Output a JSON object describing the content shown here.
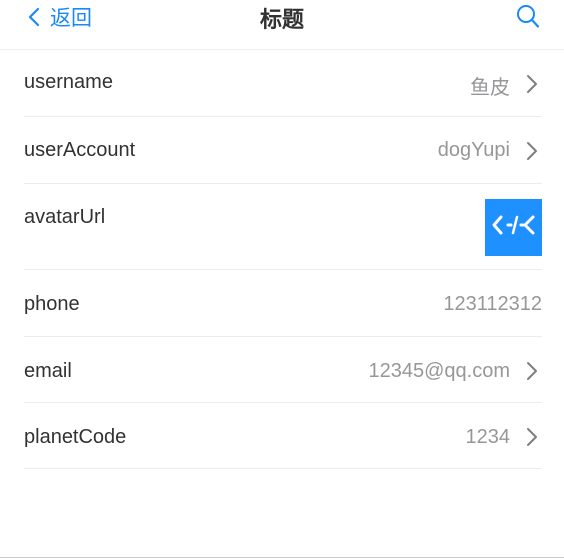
{
  "navbar": {
    "back_label": "返回",
    "title": "标题",
    "back_icon": "chevron-left-icon",
    "search_icon": "search-icon"
  },
  "cells": [
    {
      "key": "username",
      "title": "username",
      "value": "鱼皮",
      "arrow": true
    },
    {
      "key": "userAccount",
      "title": "userAccount",
      "value": "dogYupi",
      "arrow": true
    },
    {
      "key": "avatarUrl",
      "title": "avatarUrl",
      "value": "",
      "arrow": false,
      "avatar_icon": "code-logo-icon"
    },
    {
      "key": "phone",
      "title": "phone",
      "value": "123112312",
      "arrow": false
    },
    {
      "key": "email",
      "title": "email",
      "value": "12345@qq.com",
      "arrow": true
    },
    {
      "key": "planetCode",
      "title": "planetCode",
      "value": "1234",
      "arrow": true
    }
  ],
  "colors": {
    "accent": "#1989fa",
    "avatar_bg": "#1e90ff",
    "text": "#323233",
    "value_text": "#969799"
  }
}
